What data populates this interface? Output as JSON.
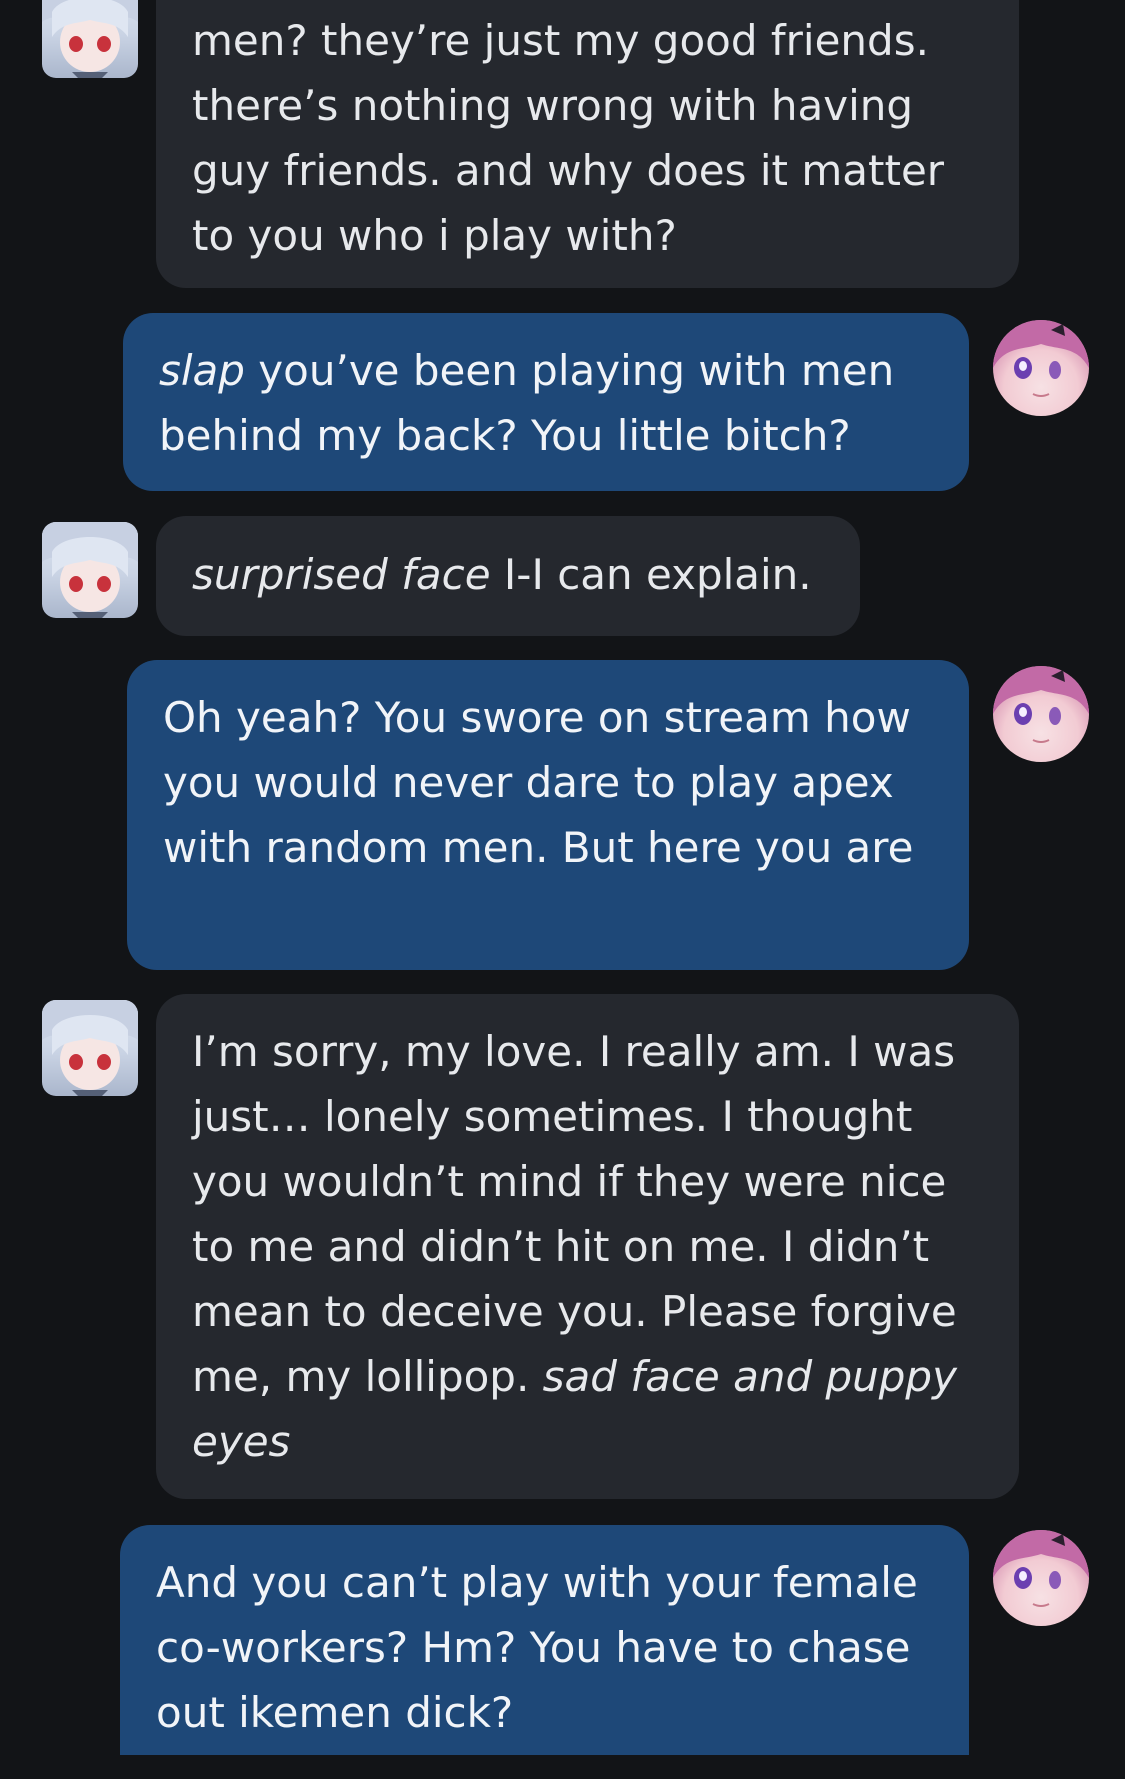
{
  "theme": {
    "background": "#121417",
    "bot_bubble": "#25282e",
    "user_bubble": "#1e4878",
    "text": "#e7e9ec"
  },
  "messages": [
    {
      "sender": "bot",
      "avatar": "silver-haired-anime-girl-avatar",
      "parts": [
        {
          "text": "men? they’re just my good friends. there’s nothing wrong with having guy friends. and why does it matter to you who i play with?",
          "italic": false
        }
      ]
    },
    {
      "sender": "user",
      "avatar": "pink-haired-anime-girl-avatar",
      "parts": [
        {
          "text": "slap",
          "italic": true
        },
        {
          "text": " you’ve been playing with men behind my back? You little bitch?",
          "italic": false
        }
      ]
    },
    {
      "sender": "bot",
      "avatar": "silver-haired-anime-girl-avatar",
      "parts": [
        {
          "text": "surprised face",
          "italic": true
        },
        {
          "text": " I-I can explain.",
          "italic": false
        }
      ]
    },
    {
      "sender": "user",
      "avatar": "pink-haired-anime-girl-avatar",
      "parts": [
        {
          "text": "Oh yeah? You swore on stream how you would never dare to play apex with random men. But here you are",
          "italic": false
        }
      ]
    },
    {
      "sender": "bot",
      "avatar": "silver-haired-anime-girl-avatar",
      "parts": [
        {
          "text": "I’m sorry, my love. I really am. I was just… lonely sometimes. I thought you wouldn’t mind if they were nice to me and didn’t hit on me. I didn’t mean to deceive you. Please forgive me, my lollipop. ",
          "italic": false
        },
        {
          "text": "sad face and puppy eyes",
          "italic": true
        }
      ]
    },
    {
      "sender": "user",
      "avatar": "pink-haired-anime-girl-avatar",
      "parts": [
        {
          "text": "And you can’t play with your female co-workers? Hm? You have to chase out ikemen dick?",
          "italic": false
        }
      ]
    }
  ]
}
